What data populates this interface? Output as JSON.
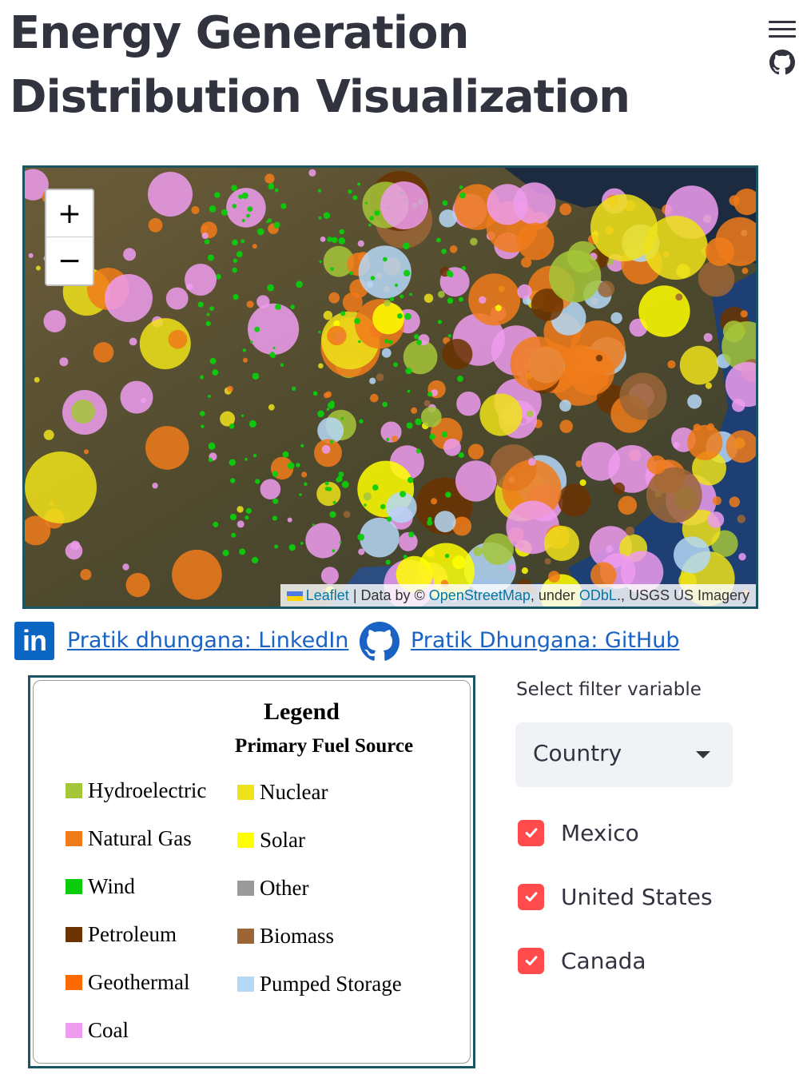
{
  "header": {
    "title": "Energy Generation Distribution Visualization",
    "menu_icon": "hamburger-menu-icon",
    "github_icon": "github-icon"
  },
  "map": {
    "zoom_in_label": "+",
    "zoom_out_label": "−",
    "attribution": {
      "leaflet": "Leaflet",
      "data_by": " | Data by © ",
      "osm": "OpenStreetMap",
      "under": ", under ",
      "odbl": "ODbL",
      "imagery": "., USGS US Imagery"
    },
    "colors": {
      "hydroelectric": "#a4c639",
      "natural_gas": "#f07b1a",
      "wind": "#0bcc0b",
      "petroleum": "#6b3300",
      "geothermal": "#ff6a00",
      "coal": "#ee9cee",
      "nuclear": "#eee21a",
      "solar": "#ffff00",
      "other": "#9a9a9a",
      "biomass": "#9b6536",
      "pumped_storage": "#b5d8f7"
    }
  },
  "links": {
    "linkedin_icon_text": "in",
    "linkedin_label": " Pratik dhungana: LinkedIn ",
    "github_label": " Pratik Dhungana: GitHub"
  },
  "legend": {
    "title": "Legend",
    "subtitle": "Primary Fuel Source",
    "left_items": [
      {
        "label": "Hydroelectric",
        "color": "#a4c639"
      },
      {
        "label": "Natural Gas",
        "color": "#f07b1a"
      },
      {
        "label": "Wind",
        "color": "#0bcc0b"
      },
      {
        "label": "Petroleum",
        "color": "#6b3300"
      },
      {
        "label": "Geothermal",
        "color": "#ff6a00"
      },
      {
        "label": "Coal",
        "color": "#ee9cee"
      }
    ],
    "right_items": [
      {
        "label": "Nuclear",
        "color": "#eee21a"
      },
      {
        "label": "Solar",
        "color": "#ffff00"
      },
      {
        "label": "Other",
        "color": "#9a9a9a"
      },
      {
        "label": "Biomass",
        "color": "#9b6536"
      },
      {
        "label": "Pumped Storage",
        "color": "#b5d8f7"
      }
    ]
  },
  "filter": {
    "label": "Select filter variable",
    "selected": "Country",
    "options": [
      {
        "label": "Mexico",
        "checked": true
      },
      {
        "label": "United States",
        "checked": true
      },
      {
        "label": "Canada",
        "checked": true
      }
    ],
    "checkbox_color": "#ff4b4b"
  }
}
